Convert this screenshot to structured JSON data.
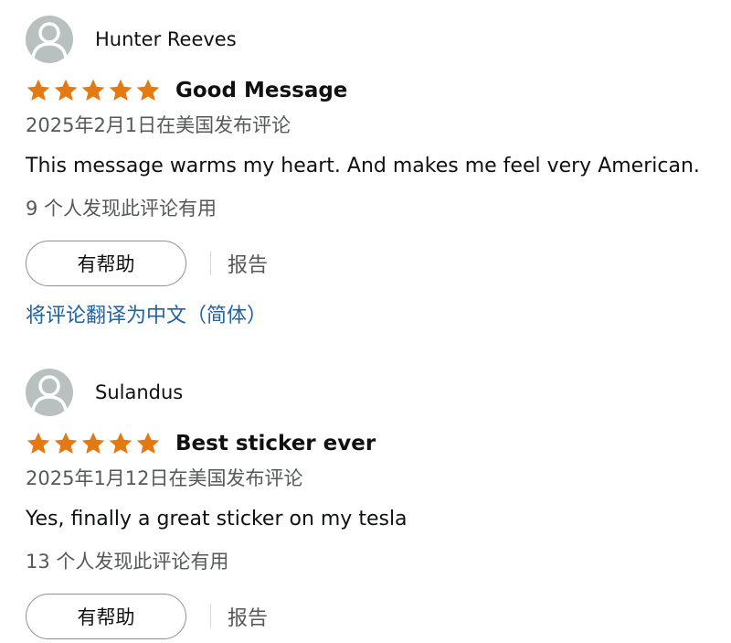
{
  "colors": {
    "star": "#e47911",
    "link": "#2162a1",
    "muted_text": "#565959",
    "avatar_bg": "#b8c0c0"
  },
  "icons": {
    "avatar": "user-silhouette-icon",
    "star": "star-filled-icon"
  },
  "reviews": [
    {
      "author": "Hunter Reeves",
      "rating": 5,
      "title": "Good Message",
      "date": "2025年2月1日在美国发布评论",
      "body": "This message warms my heart. And makes me feel very American.",
      "helpful_count": "9 个人发现此评论有用",
      "helpful_label": "有帮助",
      "report_label": "报告",
      "translate_label": "将评论翻译为中文（简体）"
    },
    {
      "author": "Sulandus",
      "rating": 5,
      "title": "Best sticker ever",
      "date": "2025年1月12日在美国发布评论",
      "body": "Yes, finally a great sticker on my tesla",
      "helpful_count": "13 个人发现此评论有用",
      "helpful_label": "有帮助",
      "report_label": "报告"
    }
  ]
}
